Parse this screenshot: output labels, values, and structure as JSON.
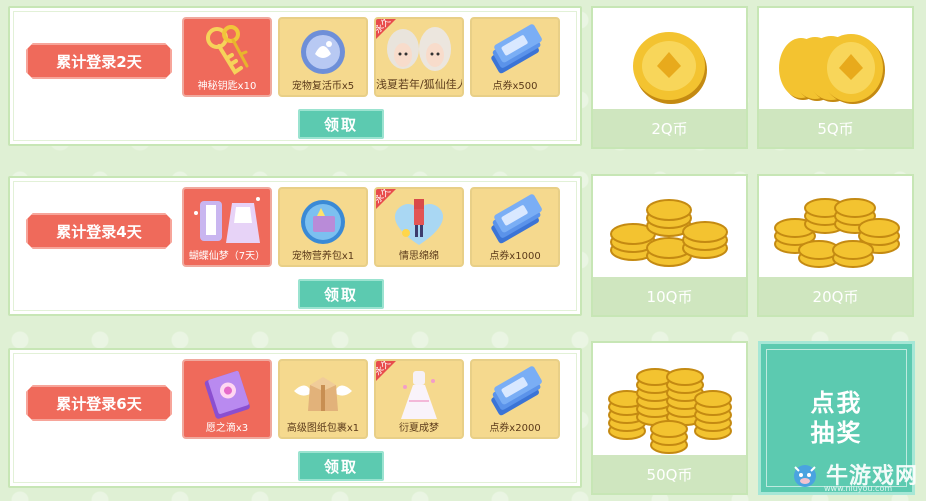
{
  "rows": [
    {
      "day_label": "累计登录2天",
      "claim_label": "领取",
      "rewards": [
        {
          "caption": "神秘钥匙x10",
          "icon": "keys-icon",
          "permanent": false
        },
        {
          "caption": "宠物复活币x5",
          "icon": "pet-revive-coin-icon",
          "permanent": false
        },
        {
          "caption": "浅夏若年/狐仙佳人",
          "icon": "hairstyle-icon",
          "permanent": true
        },
        {
          "caption": "点券x500",
          "icon": "coupon-icon",
          "permanent": false
        }
      ]
    },
    {
      "day_label": "累计登录4天",
      "claim_label": "领取",
      "rewards": [
        {
          "caption": "蝴蝶仙梦（7天）",
          "icon": "outfit-set-icon",
          "permanent": false
        },
        {
          "caption": "宠物营养包x1",
          "icon": "pet-nutrition-pack-icon",
          "permanent": false
        },
        {
          "caption": "情思绵绵",
          "icon": "heart-character-icon",
          "permanent": true
        },
        {
          "caption": "点券x1000",
          "icon": "coupon-icon",
          "permanent": false
        }
      ]
    },
    {
      "day_label": "累计登录6天",
      "claim_label": "领取",
      "rewards": [
        {
          "caption": "愿之滴x3",
          "icon": "purple-book-icon",
          "permanent": false
        },
        {
          "caption": "高级图纸包裹x1",
          "icon": "winged-package-icon",
          "permanent": false
        },
        {
          "caption": "衍夏成梦",
          "icon": "dress-icon",
          "permanent": true
        },
        {
          "caption": "点券x2000",
          "icon": "coupon-icon",
          "permanent": false
        }
      ]
    }
  ],
  "permanent_tag": "永久",
  "qcoin_cards": [
    {
      "label": "2Q币",
      "icon": "gold-coin-icon"
    },
    {
      "label": "5Q币",
      "icon": "gold-coins-icon"
    },
    {
      "label": "10Q币",
      "icon": "gold-coin-stack-icon"
    },
    {
      "label": "20Q币",
      "icon": "gold-coin-stack-icon"
    },
    {
      "label": "50Q币",
      "icon": "gold-coin-pile-icon"
    }
  ],
  "draw_button": {
    "line1": "点我",
    "line2": "抽奖"
  },
  "watermark": {
    "text": "牛游戏网",
    "sub": "www.niuyou.com"
  },
  "colors": {
    "accent_red": "#ef6a5b",
    "accent_teal": "#5ccab0",
    "border_green": "#c7e6b5",
    "reward_gold": "#f5d98e"
  }
}
